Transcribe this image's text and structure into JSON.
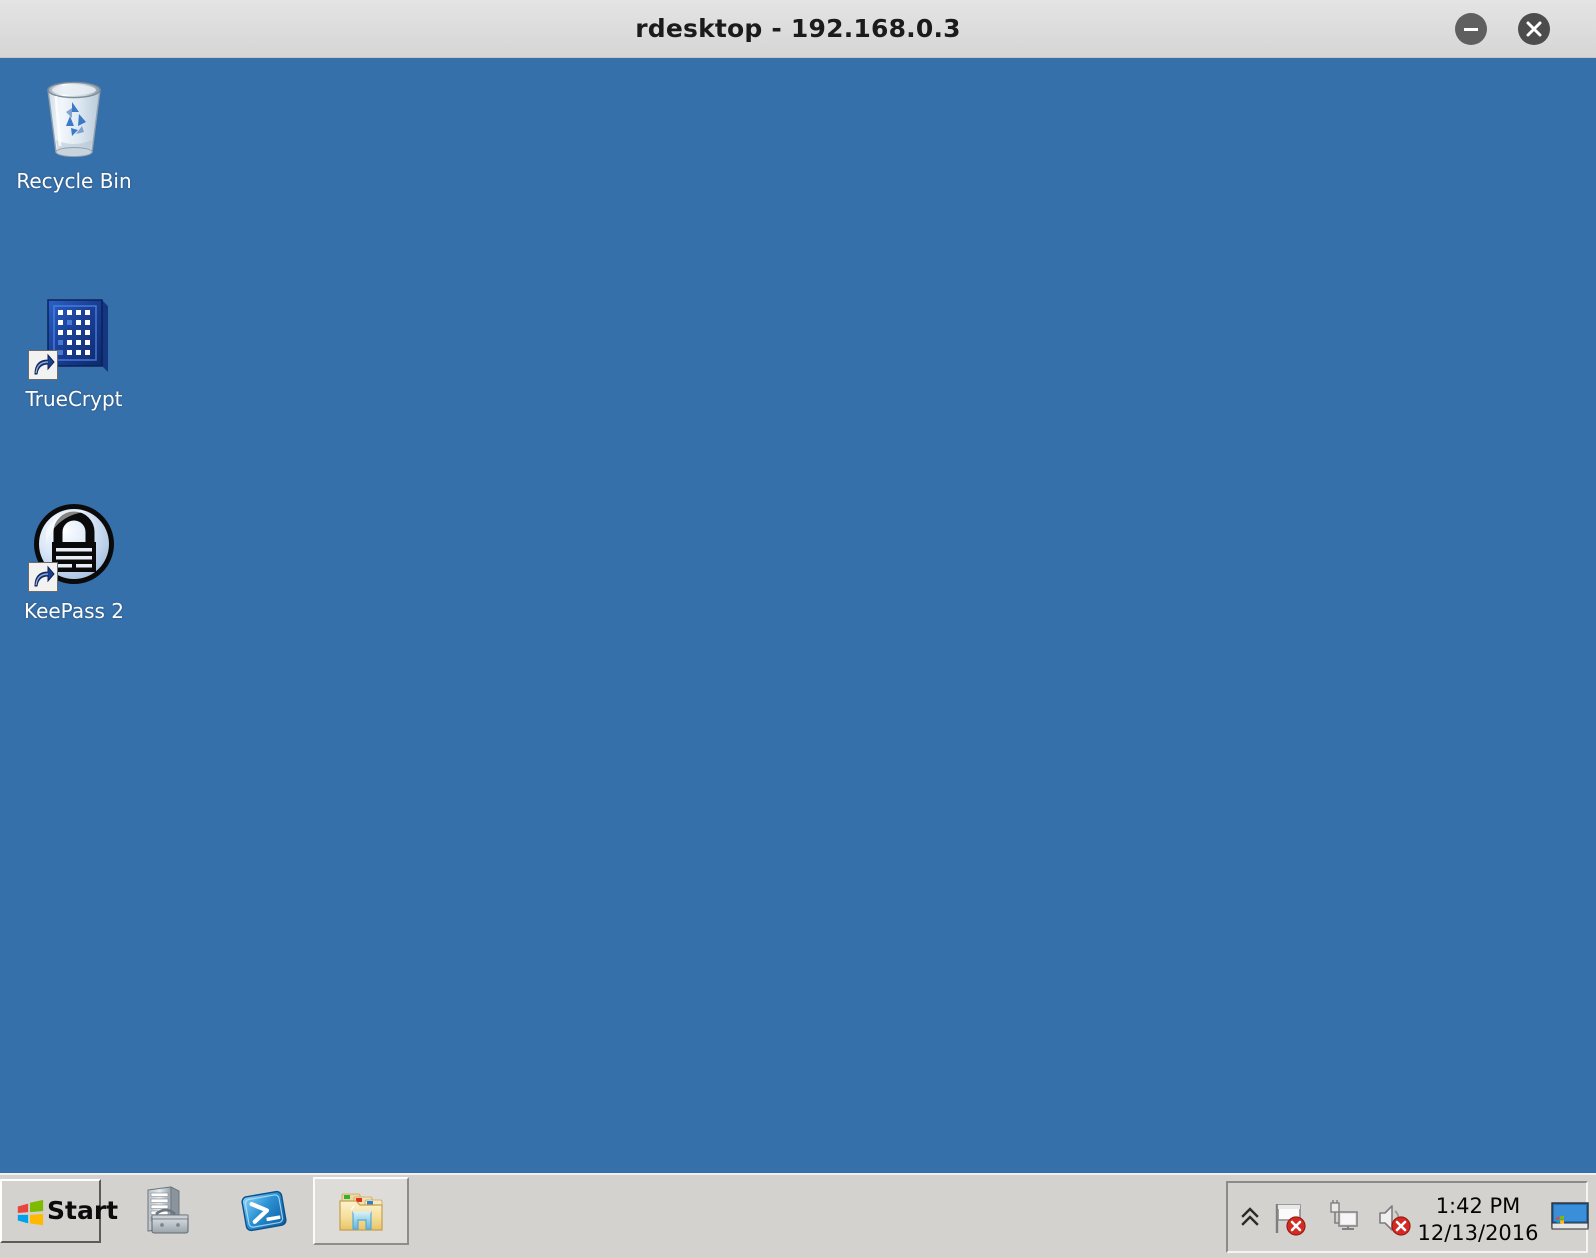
{
  "window": {
    "title": "rdesktop - 192.168.0.3",
    "controls": [
      {
        "name": "minimize-button",
        "icon": "minimize-icon",
        "label": "Minimize"
      },
      {
        "name": "close-button",
        "icon": "close-icon",
        "label": "Close"
      }
    ]
  },
  "desktop": {
    "background_color": "#3670ab",
    "icons": [
      {
        "label": "Recycle Bin",
        "icon": "recycle-bin-icon",
        "shortcut": false
      },
      {
        "label": "TrueCrypt",
        "icon": "truecrypt-icon",
        "shortcut": true
      },
      {
        "label": "KeePass 2",
        "icon": "keepass-icon",
        "shortcut": true
      }
    ]
  },
  "taskbar": {
    "background_color": "#d4d2ce",
    "start": {
      "label": "Start",
      "icon": "windows-logo-icon"
    },
    "quick_launch": [
      {
        "label": "Server Manager",
        "icon": "server-manager-icon",
        "active": false
      },
      {
        "label": "Windows PowerShell",
        "icon": "powershell-icon",
        "active": false
      },
      {
        "label": "Windows Explorer",
        "icon": "folder-explorer-icon",
        "active": true
      }
    ],
    "tray": {
      "expand": {
        "label": "Show hidden icons",
        "icon": "chevron-up-icon"
      },
      "icons": [
        {
          "label": "Action Center",
          "icon": "flag-warning-icon",
          "status": "error"
        },
        {
          "label": "Network",
          "icon": "network-warning-icon",
          "status": "error"
        },
        {
          "label": "Volume",
          "icon": "speaker-muted-icon",
          "status": "error"
        }
      ],
      "clock": {
        "time": "1:42 PM",
        "date": "12/13/2016"
      },
      "show_desktop": {
        "label": "Show desktop",
        "icon": "show-desktop-icon"
      }
    }
  }
}
